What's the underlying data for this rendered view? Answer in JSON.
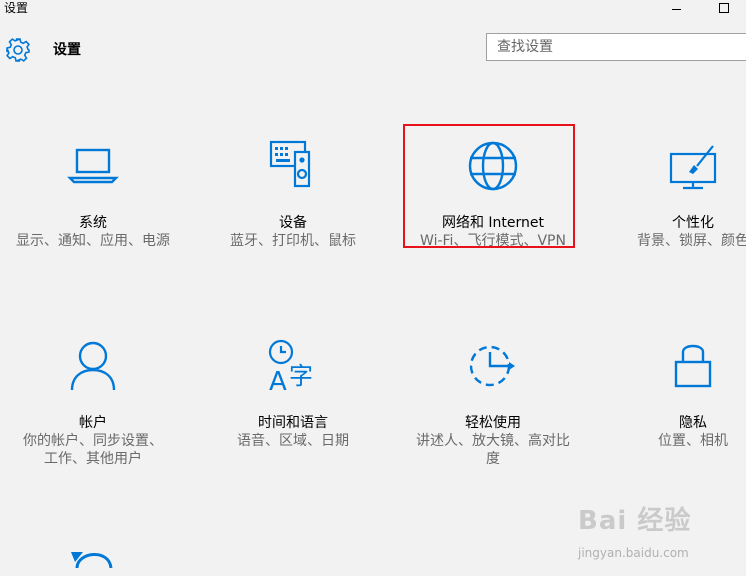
{
  "window": {
    "title": "设置"
  },
  "header": {
    "title": "设置",
    "search_placeholder": "查找设置"
  },
  "tiles": [
    {
      "title": "系统",
      "desc": "显示、通知、应用、电源",
      "icon": "laptop-icon"
    },
    {
      "title": "设备",
      "desc": "蓝牙、打印机、鼠标",
      "icon": "devices-icon"
    },
    {
      "title": "网络和 Internet",
      "desc": "Wi-Fi、飞行模式、VPN",
      "icon": "globe-icon"
    },
    {
      "title": "个性化",
      "desc": "背景、锁屏、颜色",
      "icon": "personalization-icon"
    },
    {
      "title": "帐户",
      "desc": "你的帐户、同步设置、工作、其他用户",
      "icon": "person-icon"
    },
    {
      "title": "时间和语言",
      "desc": "语音、区域、日期",
      "icon": "time-language-icon"
    },
    {
      "title": "轻松使用",
      "desc": "讲述人、放大镜、高对比度",
      "icon": "ease-of-access-icon"
    },
    {
      "title": "隐私",
      "desc": "位置、相机",
      "icon": "lock-icon"
    },
    {
      "title": "",
      "desc": "",
      "icon": "update-icon"
    }
  ],
  "watermark": {
    "text": "Bai 经验",
    "sub": "jingyan.baidu.com"
  },
  "colors": {
    "accent": "#0078d7",
    "highlight": "#e8121a",
    "background": "#f2f2f2"
  }
}
